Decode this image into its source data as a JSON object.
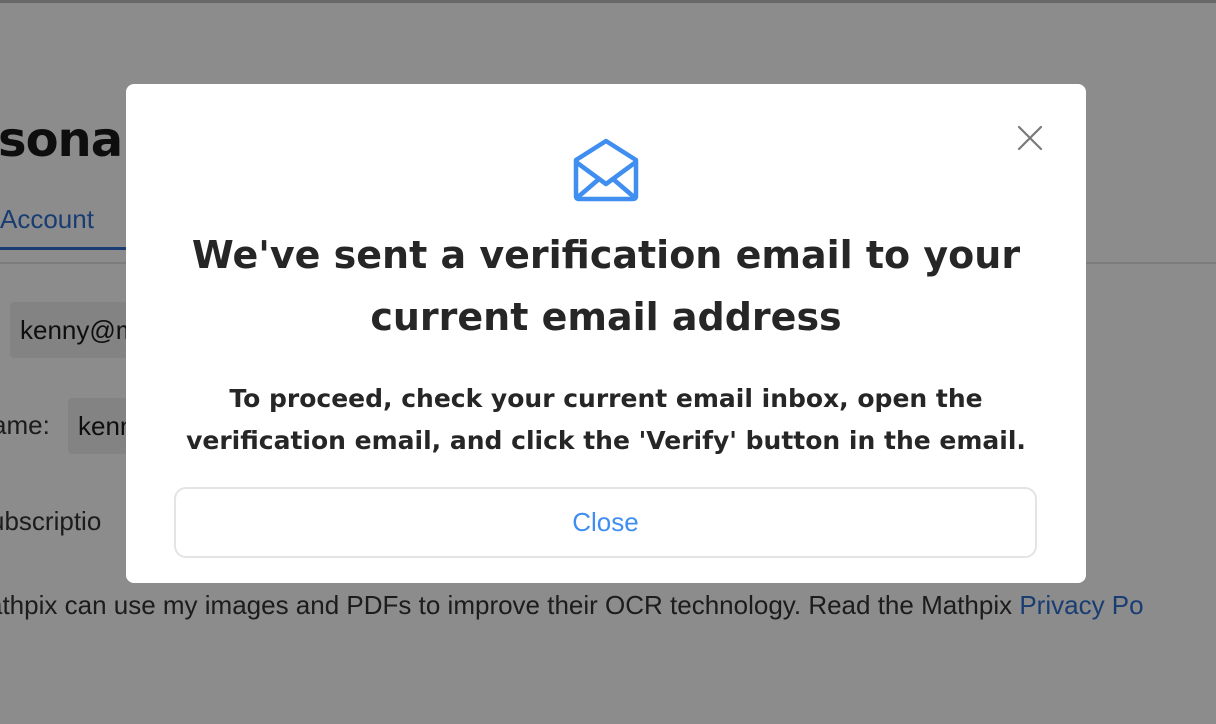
{
  "background": {
    "page_title": "sonal",
    "tab_account": "Account",
    "email_value": "kenny@m",
    "name_label": "ame:",
    "name_value": "kenn",
    "subscription_label": "ubscriptio",
    "consent_text": "athpix can use my images and PDFs to improve their OCR technology. Read the Mathpix ",
    "privacy_link": "Privacy Po"
  },
  "modal": {
    "icon": "mail-open-icon",
    "close_icon": "close-icon",
    "title": "We've sent a verification email to your current email address",
    "body": "To proceed, check your current email inbox, open the verification email, and click the 'Verify' button in the email.",
    "close_label": "Close"
  },
  "colors": {
    "accent": "#3f8ef0",
    "link": "#2f6fd0",
    "overlay": "rgba(0,0,0,0.45)"
  }
}
